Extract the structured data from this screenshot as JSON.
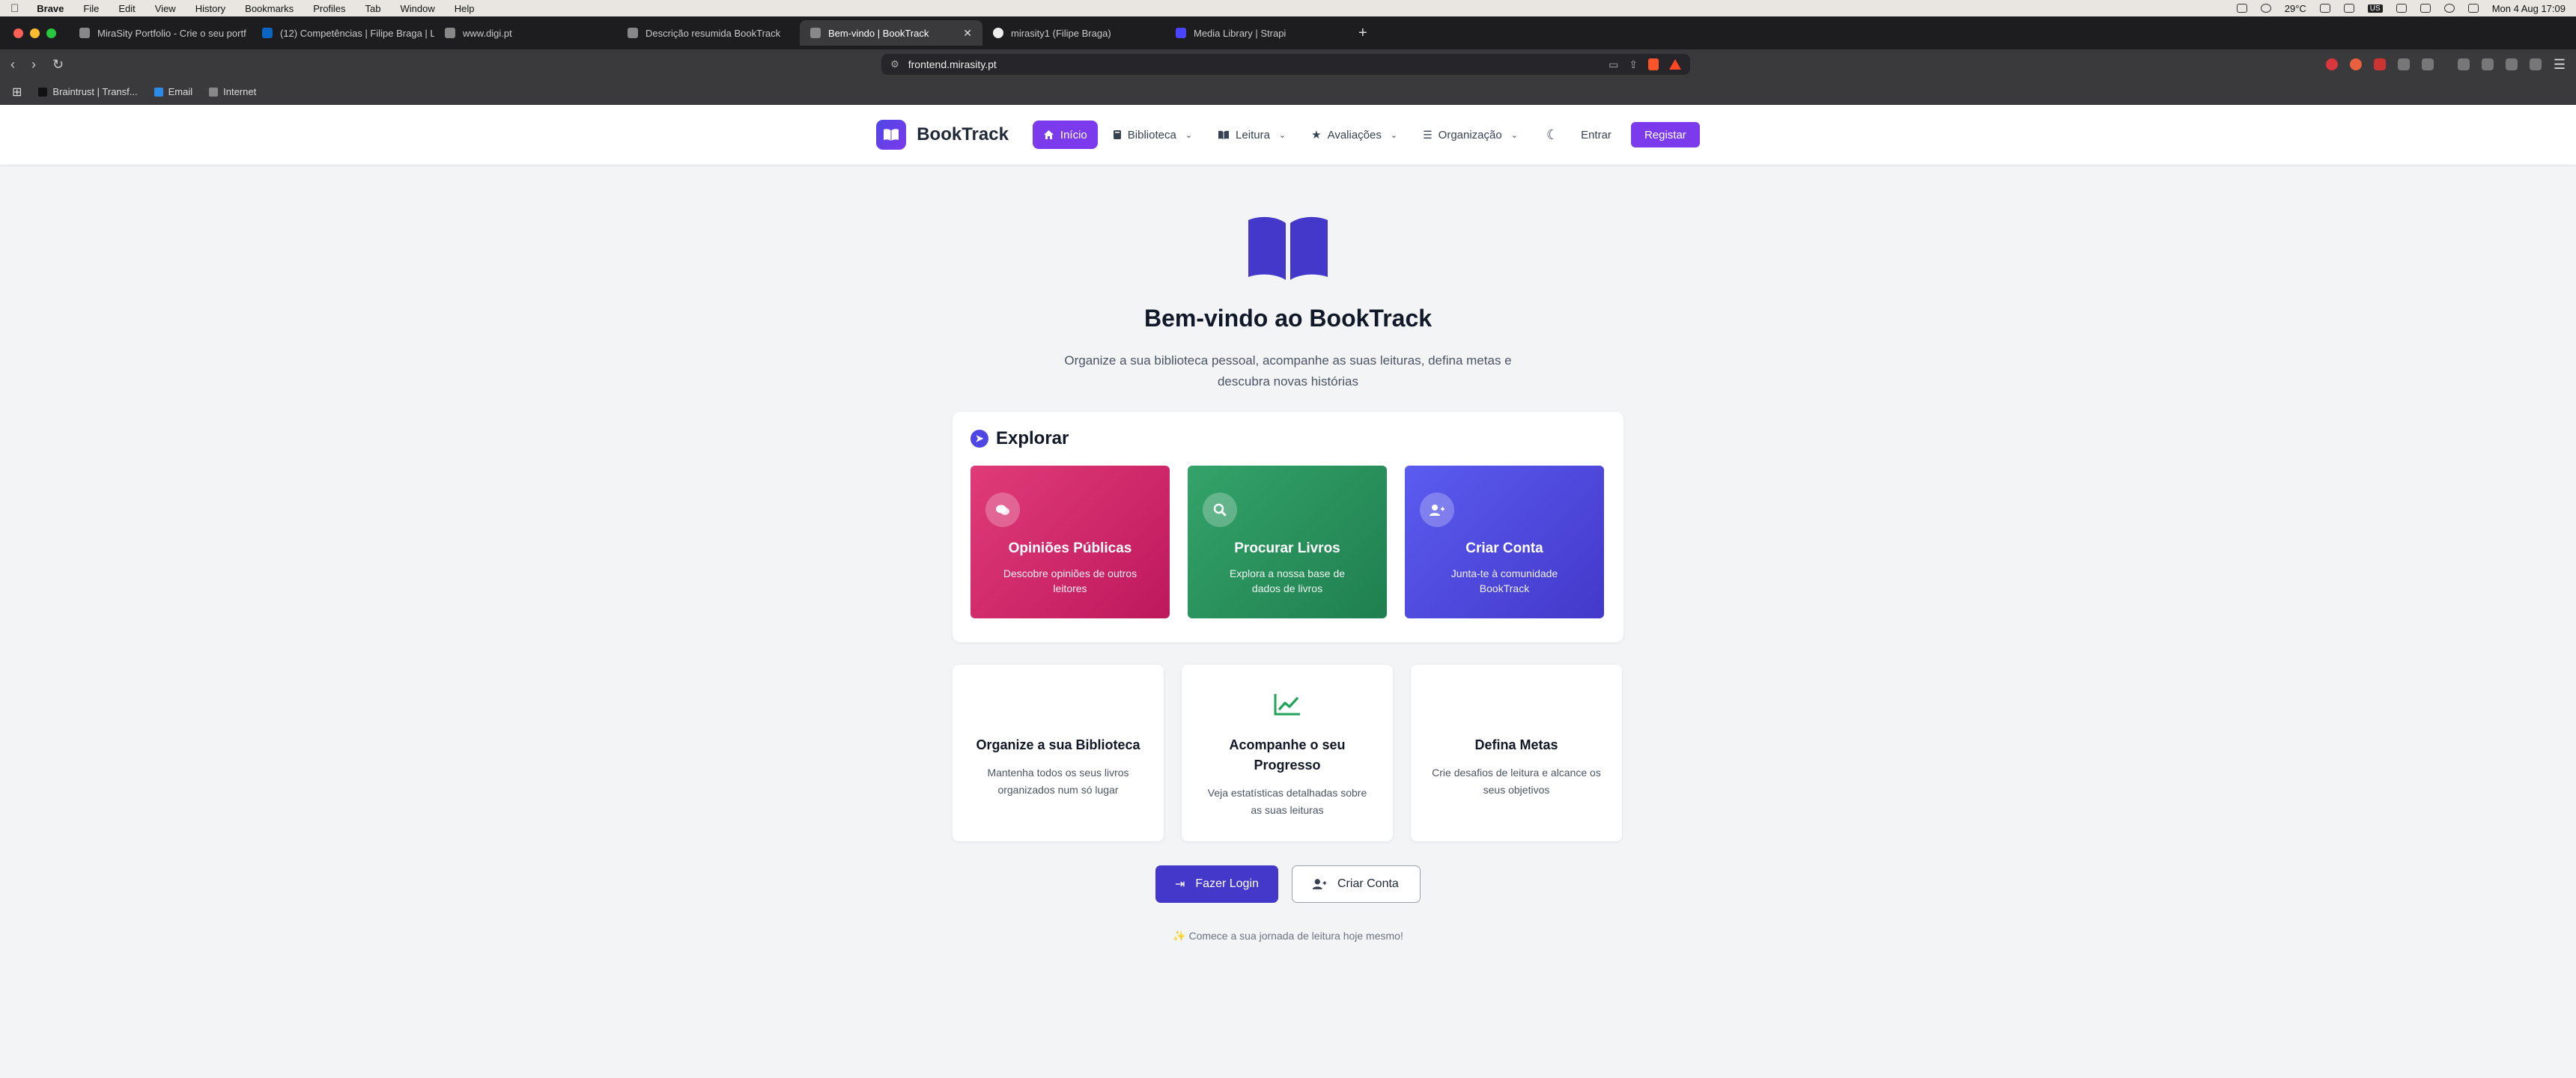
{
  "menubar": {
    "app": "Brave",
    "items": [
      "File",
      "Edit",
      "View",
      "History",
      "Bookmarks",
      "Profiles",
      "Tab",
      "Window",
      "Help"
    ],
    "weather": "29°C",
    "datetime": "Mon 4 Aug  17:09",
    "keyboard": "US"
  },
  "tabs": [
    {
      "title": "MiraSity Portfolio - Crie o seu portf",
      "active": false
    },
    {
      "title": "(12) Competências | Filipe Braga | L",
      "active": false
    },
    {
      "title": "www.digi.pt",
      "active": false
    },
    {
      "title": "Descrição resumida BookTrack",
      "active": false
    },
    {
      "title": "Bem-vindo | BookTrack",
      "active": true
    },
    {
      "title": "mirasity1 (Filipe Braga)",
      "active": false
    },
    {
      "title": "Media Library | Strapi",
      "active": false
    }
  ],
  "toolbar": {
    "url": "frontend.mirasity.pt"
  },
  "bookmarks": [
    {
      "label": "Braintrust | Transf..."
    },
    {
      "label": "Email"
    },
    {
      "label": "Internet"
    }
  ],
  "nav": {
    "brand": "BookTrack",
    "items": [
      {
        "label": "Início",
        "icon": "home-icon",
        "active": true,
        "dropdown": false
      },
      {
        "label": "Biblioteca",
        "icon": "book-icon",
        "active": false,
        "dropdown": true
      },
      {
        "label": "Leitura",
        "icon": "open-book-icon",
        "active": false,
        "dropdown": true
      },
      {
        "label": "Avaliações",
        "icon": "star-icon",
        "active": false,
        "dropdown": true
      },
      {
        "label": "Organização",
        "icon": "list-icon",
        "active": false,
        "dropdown": true
      }
    ],
    "login": "Entrar",
    "register": "Registar"
  },
  "hero": {
    "title": "Bem-vindo ao BookTrack",
    "subtitle": "Organize a sua biblioteca pessoal, acompanhe as suas leituras, defina metas e descubra novas histórias"
  },
  "explore": {
    "title": "Explorar",
    "cards": [
      {
        "title": "Opiniões Públicas",
        "desc": "Descobre opiniões de outros leitores",
        "icon": "comments-icon",
        "color": "#db2777"
      },
      {
        "title": "Procurar Livros",
        "desc": "Explora a nossa base de dados de livros",
        "icon": "search-icon",
        "color": "#2f9461"
      },
      {
        "title": "Criar Conta",
        "desc": "Junta-te à comunidade BookTrack",
        "icon": "user-plus-icon",
        "color": "#4f46e5"
      }
    ]
  },
  "features": [
    {
      "title": "Organize a sua Biblioteca",
      "desc": "Mantenha todos os seus livros organizados num só lugar"
    },
    {
      "title": "Acompanhe o seu Progresso",
      "desc": "Veja estatísticas detalhadas sobre as suas leituras"
    },
    {
      "title": "Defina Metas",
      "desc": "Crie desafios de leitura e alcance os seus objetivos"
    }
  ],
  "actions": {
    "login": "Fazer Login",
    "signup": "Criar Conta"
  },
  "tagline": "✨ Comece a sua jornada de leitura hoje mesmo!",
  "colors": {
    "accent": "#7c3aed",
    "primary": "#4338ca",
    "background": "#f3f4f6"
  }
}
